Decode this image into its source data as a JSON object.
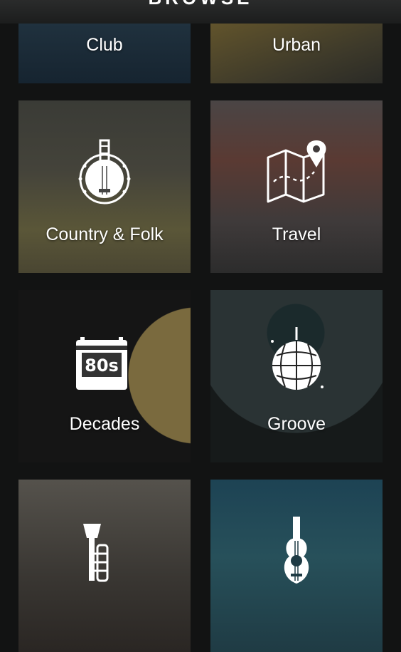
{
  "header": {
    "title": "BROWSE"
  },
  "tiles": [
    {
      "label": "Club",
      "icon": "none"
    },
    {
      "label": "Urban",
      "icon": "none"
    },
    {
      "label": "Country & Folk",
      "icon": "banjo-icon"
    },
    {
      "label": "Travel",
      "icon": "map-pin-icon"
    },
    {
      "label": "Decades",
      "icon": "calendar-80s-icon",
      "icon_text": "80s"
    },
    {
      "label": "Groove",
      "icon": "disco-ball-icon"
    },
    {
      "label": "",
      "icon": "trumpet-icon"
    },
    {
      "label": "",
      "icon": "guitar-icon"
    }
  ]
}
